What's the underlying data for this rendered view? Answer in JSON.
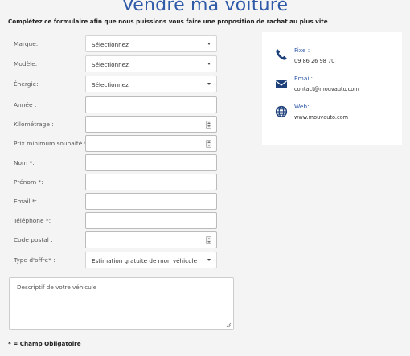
{
  "page": {
    "title": "Vendre ma voiture",
    "subtitle": "Complétez ce formulaire afin que nous puissions vous faire une proposition de rachat au plus vite"
  },
  "form": {
    "marque": {
      "label": "Marque:",
      "value": "Sélectionnez"
    },
    "modele": {
      "label": "Modèle:",
      "value": "Sélectionnez"
    },
    "energie": {
      "label": "Énergie:",
      "value": "Sélectionnez"
    },
    "annee": {
      "label": "Année :",
      "value": ""
    },
    "kilometrage": {
      "label": "Kilométrage :",
      "value": ""
    },
    "prix": {
      "label": "Prix minimum souhaité *:",
      "value": ""
    },
    "nom": {
      "label": "Nom *:",
      "value": ""
    },
    "prenom": {
      "label": "Prénom *:",
      "value": ""
    },
    "email": {
      "label": "Email *:",
      "value": ""
    },
    "telephone": {
      "label": "Téléphone *:",
      "value": ""
    },
    "code_postal": {
      "label": "Code postal :",
      "value": ""
    },
    "type_offre": {
      "label": "Type d'offre* :",
      "value": "Estimation gratuite de mon véhicule"
    },
    "description_placeholder": "Descriptif de votre véhicule",
    "required_note": "* = Champ Obligatoire"
  },
  "contact": {
    "phone": {
      "label": "Fixe :",
      "value": "09 86 26 98 70",
      "icon": "phone-icon"
    },
    "email": {
      "label": "Email:",
      "value": "contact@mouvauto.com",
      "icon": "envelope-icon"
    },
    "web": {
      "label": "Web:",
      "value": "www.mouvauto.com",
      "icon": "globe-icon"
    }
  },
  "colors": {
    "accent": "#2f5aa8",
    "icon": "#1d3f7a",
    "background": "#f4f4f5"
  }
}
